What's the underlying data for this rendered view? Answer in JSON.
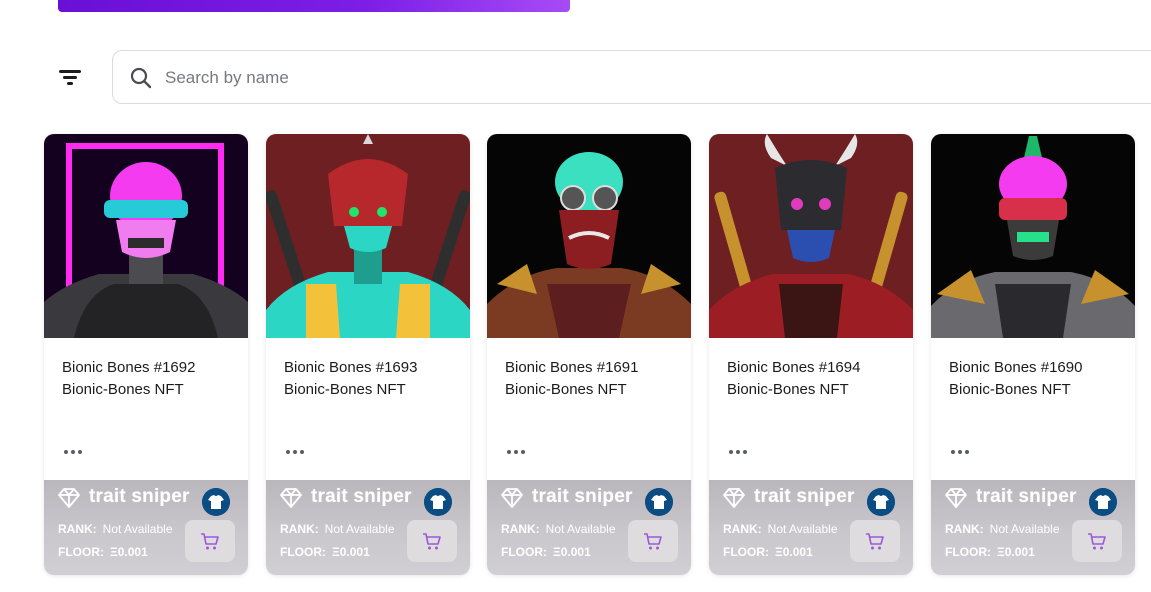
{
  "search": {
    "placeholder": "Search by name"
  },
  "colors": {
    "accent": "#7c1ee6",
    "cart_icon": "#9b59d6",
    "shirt_badge": "#0b4d83"
  },
  "cards": [
    {
      "name": "Bionic Bones #1692",
      "collection": "Bionic-Bones NFT",
      "brand": "trait sniper",
      "rank_label": "RANK:",
      "rank_value": "Not Available",
      "floor_label": "FLOOR:",
      "floor_value": "Ξ0.001"
    },
    {
      "name": "Bionic Bones #1693",
      "collection": "Bionic-Bones NFT",
      "brand": "trait sniper",
      "rank_label": "RANK:",
      "rank_value": "Not Available",
      "floor_label": "FLOOR:",
      "floor_value": "Ξ0.001"
    },
    {
      "name": "Bionic Bones #1691",
      "collection": "Bionic-Bones NFT",
      "brand": "trait sniper",
      "rank_label": "RANK:",
      "rank_value": "Not Available",
      "floor_label": "FLOOR:",
      "floor_value": "Ξ0.001"
    },
    {
      "name": "Bionic Bones #1694",
      "collection": "Bionic-Bones NFT",
      "brand": "trait sniper",
      "rank_label": "RANK:",
      "rank_value": "Not Available",
      "floor_label": "FLOOR:",
      "floor_value": "Ξ0.001"
    },
    {
      "name": "Bionic Bones #1690",
      "collection": "Bionic-Bones NFT",
      "brand": "trait sniper",
      "rank_label": "RANK:",
      "rank_value": "Not Available",
      "floor_label": "FLOOR:",
      "floor_value": "Ξ0.001"
    }
  ]
}
